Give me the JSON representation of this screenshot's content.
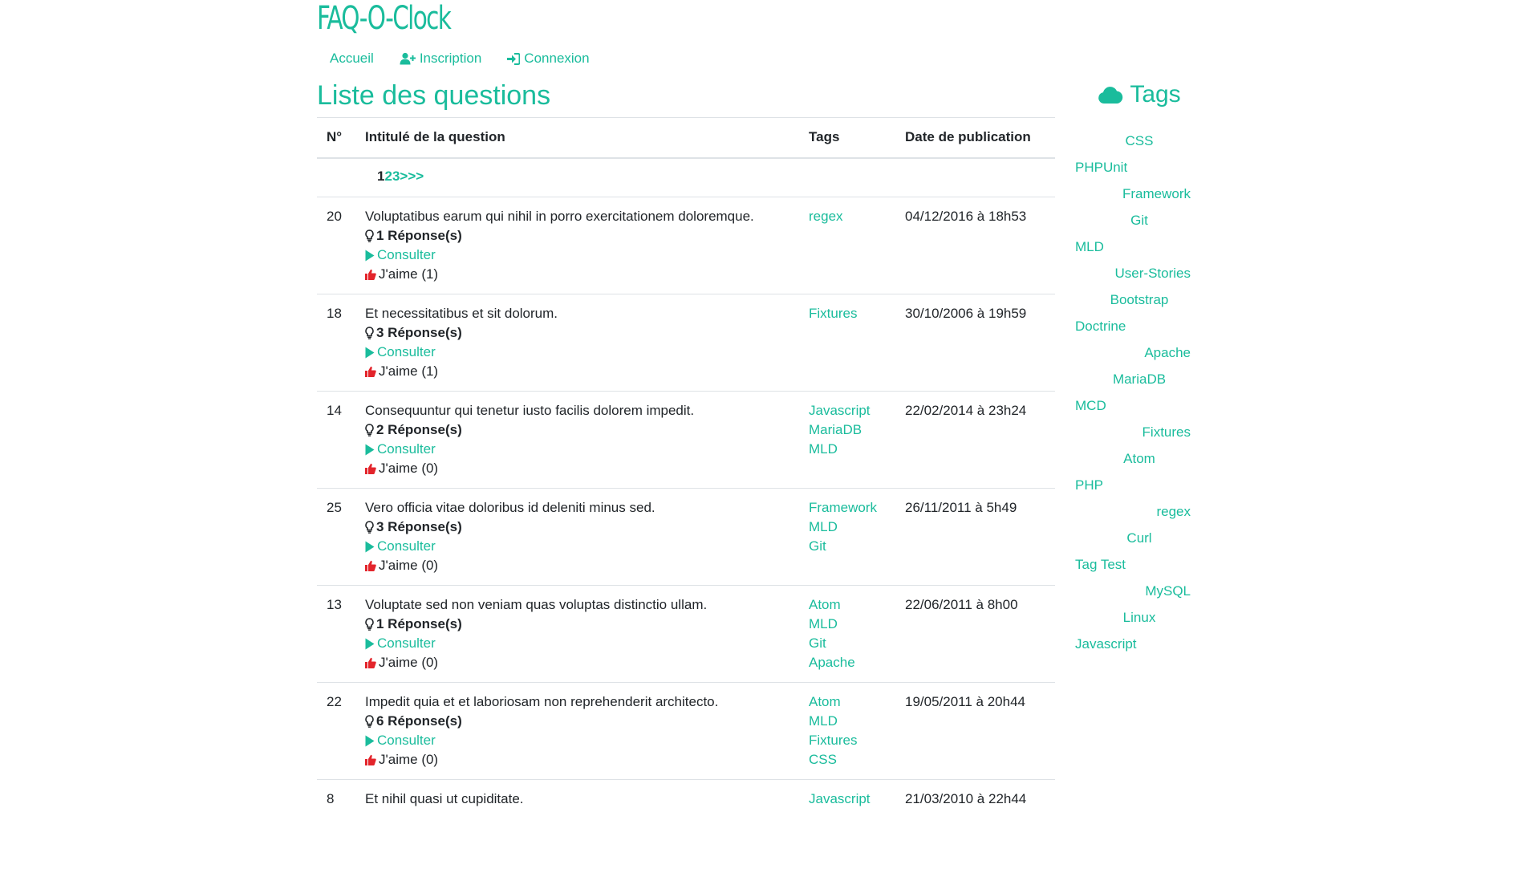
{
  "brand": "FAQ-O-Clock",
  "nav": {
    "home": "Accueil",
    "signup": "Inscription",
    "login": "Connexion"
  },
  "main": {
    "title": "Liste des questions",
    "headers": {
      "num": "N°",
      "question": "Intitulé de la question",
      "tags": "Tags",
      "date": "Date de publication"
    },
    "pager": {
      "current": "1",
      "page2": "2",
      "page3": "3",
      "next": ">>>"
    },
    "questions": [
      {
        "num": "20",
        "title": "Voluptatibus earum qui nihil in porro exercitationem doloremque.",
        "answers": "1 Réponse(s)",
        "consult": "Consulter",
        "like": "J'aime (1)",
        "tags": [
          "regex"
        ],
        "date": "04/12/2016 à 18h53"
      },
      {
        "num": "18",
        "title": "Et necessitatibus et sit dolorum.",
        "answers": "3 Réponse(s)",
        "consult": "Consulter",
        "like": "J'aime (1)",
        "tags": [
          "Fixtures"
        ],
        "date": "30/10/2006 à 19h59"
      },
      {
        "num": "14",
        "title": "Consequuntur qui tenetur iusto facilis dolorem impedit.",
        "answers": "2 Réponse(s)",
        "consult": "Consulter",
        "like": "J'aime (0)",
        "tags": [
          "Javascript",
          "MariaDB",
          "MLD"
        ],
        "date": "22/02/2014 à 23h24"
      },
      {
        "num": "25",
        "title": "Vero officia vitae doloribus id deleniti minus sed.",
        "answers": "3 Réponse(s)",
        "consult": "Consulter",
        "like": "J'aime (0)",
        "tags": [
          "Framework",
          "MLD",
          "Git"
        ],
        "date": "26/11/2011 à 5h49"
      },
      {
        "num": "13",
        "title": "Voluptate sed non veniam quas voluptas distinctio ullam.",
        "answers": "1 Réponse(s)",
        "consult": "Consulter",
        "like": "J'aime (0)",
        "tags": [
          "Atom",
          "MLD",
          "Git",
          "Apache"
        ],
        "date": "22/06/2011 à 8h00"
      },
      {
        "num": "22",
        "title": "Impedit quia et et laboriosam non reprehenderit architecto.",
        "answers": "6 Réponse(s)",
        "consult": "Consulter",
        "like": "J'aime (0)",
        "tags": [
          "Atom",
          "MLD",
          "Fixtures",
          "CSS"
        ],
        "date": "19/05/2011 à 20h44"
      },
      {
        "num": "8",
        "title": "Et nihil quasi ut cupiditate.",
        "answers": "",
        "consult": "",
        "like": "",
        "tags": [
          "Javascript"
        ],
        "date": "21/03/2010 à 22h44"
      }
    ]
  },
  "sidebar": {
    "title": "Tags",
    "tags": [
      {
        "label": "CSS",
        "align": "center"
      },
      {
        "label": "PHPUnit",
        "align": "left"
      },
      {
        "label": "Framework",
        "align": "right"
      },
      {
        "label": "Git",
        "align": "center"
      },
      {
        "label": "MLD",
        "align": "left"
      },
      {
        "label": "User-Stories",
        "align": "right"
      },
      {
        "label": "Bootstrap",
        "align": "center"
      },
      {
        "label": "Doctrine",
        "align": "left"
      },
      {
        "label": "Apache",
        "align": "right"
      },
      {
        "label": "MariaDB",
        "align": "center"
      },
      {
        "label": "MCD",
        "align": "left"
      },
      {
        "label": "Fixtures",
        "align": "right"
      },
      {
        "label": "Atom",
        "align": "center"
      },
      {
        "label": "PHP",
        "align": "left"
      },
      {
        "label": "regex",
        "align": "right"
      },
      {
        "label": "Curl",
        "align": "center"
      },
      {
        "label": "Tag Test",
        "align": "left"
      },
      {
        "label": "MySQL",
        "align": "right"
      },
      {
        "label": "Linux",
        "align": "center"
      },
      {
        "label": "Javascript",
        "align": "left"
      }
    ]
  },
  "colors": {
    "accent": "#1abc9c",
    "like": "#e3242b",
    "text": "#212529",
    "border": "#dee2e6"
  },
  "icons": {
    "signup": "user-plus-icon",
    "login": "sign-in-icon",
    "answers": "lightbulb-icon",
    "consult": "play-icon",
    "like": "thumbs-up-icon",
    "tags": "cloud-icon"
  }
}
